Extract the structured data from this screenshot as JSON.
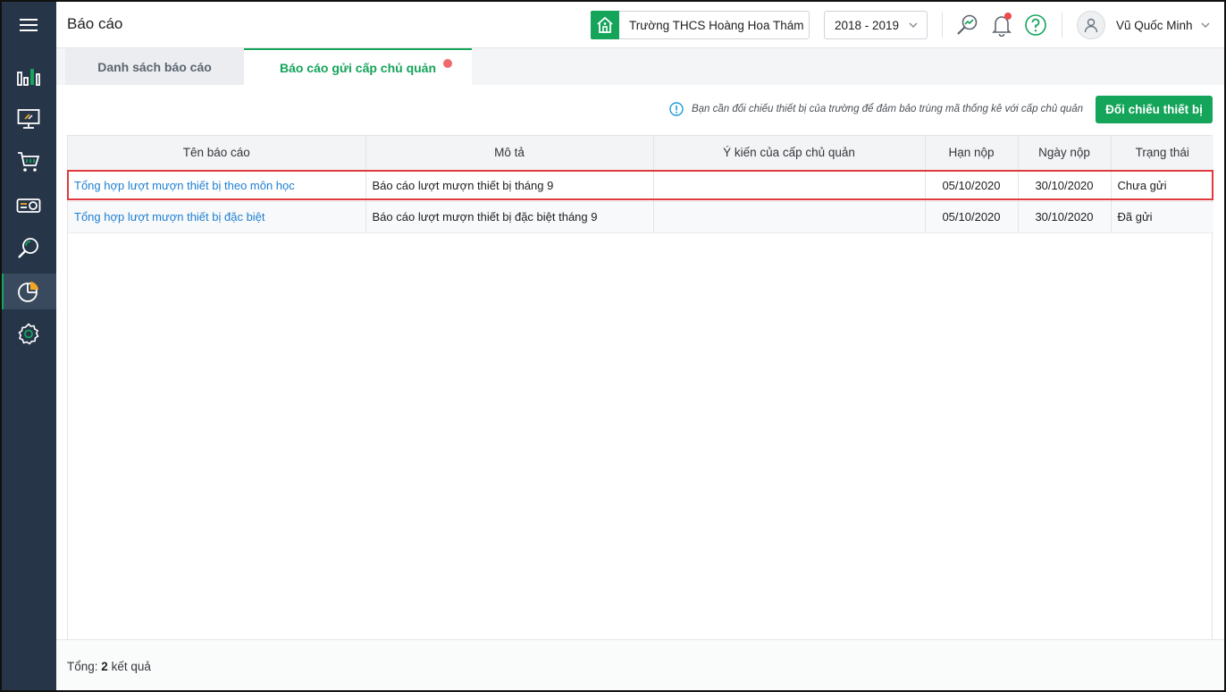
{
  "sidebar": {
    "items": [
      {
        "name": "menu"
      },
      {
        "name": "dashboard"
      },
      {
        "name": "devices"
      },
      {
        "name": "purchase"
      },
      {
        "name": "equipment"
      },
      {
        "name": "search"
      },
      {
        "name": "reports"
      },
      {
        "name": "settings"
      }
    ],
    "active_item": "reports",
    "accent_color": "#14a45a"
  },
  "header": {
    "title": "Báo cáo",
    "school": "Trường THCS Hoàng Hoa Thám",
    "school_year": "2018 - 2019",
    "user_name": "Vũ Quốc Minh"
  },
  "tabs": [
    {
      "label": "Danh sách báo cáo",
      "active": false
    },
    {
      "label": "Báo cáo gửi cấp chủ quản",
      "active": true,
      "has_notification": true
    }
  ],
  "toolbar": {
    "notice": "Bạn cần đối chiếu thiết bị của trường để đảm bảo trùng mã thống kê với cấp chủ quản",
    "check_button": "Đối chiếu thiết bị"
  },
  "table": {
    "columns": [
      "Tên báo cáo",
      "Mô tả",
      "Ý kiến của cấp chủ quản",
      "Hạn nộp",
      "Ngày nộp",
      "Trạng thái"
    ],
    "rows": [
      {
        "name": "Tổng hợp lượt mượn thiết bị theo môn học",
        "description": "Báo cáo lượt mượn thiết bị tháng 9",
        "feedback": "",
        "deadline": "05/10/2020",
        "submitted": "30/10/2020",
        "status": "Chưa gửi"
      },
      {
        "name": "Tổng hợp lượt mượn thiết bị đặc biệt",
        "description": "Báo cáo lượt mượn thiết bị đặc biệt tháng 9",
        "feedback": "",
        "deadline": "05/10/2020",
        "submitted": "30/10/2020",
        "status": "Đã gửi"
      }
    ]
  },
  "footer": {
    "total_label": "Tổng:",
    "total_count": "2",
    "total_suffix": "kết quả"
  }
}
